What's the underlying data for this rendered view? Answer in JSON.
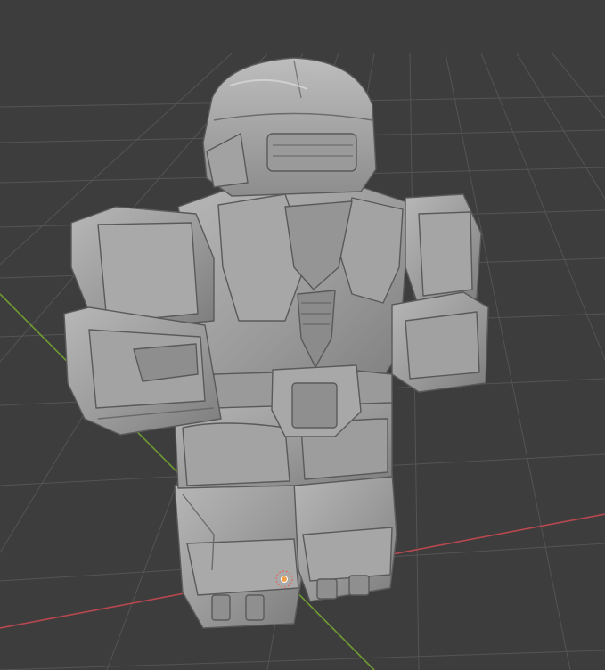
{
  "viewport": {
    "background": "#3d3d3d",
    "grid_color": "#545454",
    "x_axis_color": "#b8474f",
    "y_axis_color": "#6f9a31"
  },
  "model": {
    "description_icon": "armored-mech-figure",
    "material_color": "#9c9c9c"
  },
  "origin_marker": {
    "icon": "object-origin-icon",
    "ring_color": "#e06a5a",
    "center_color": "#f3a04a"
  }
}
